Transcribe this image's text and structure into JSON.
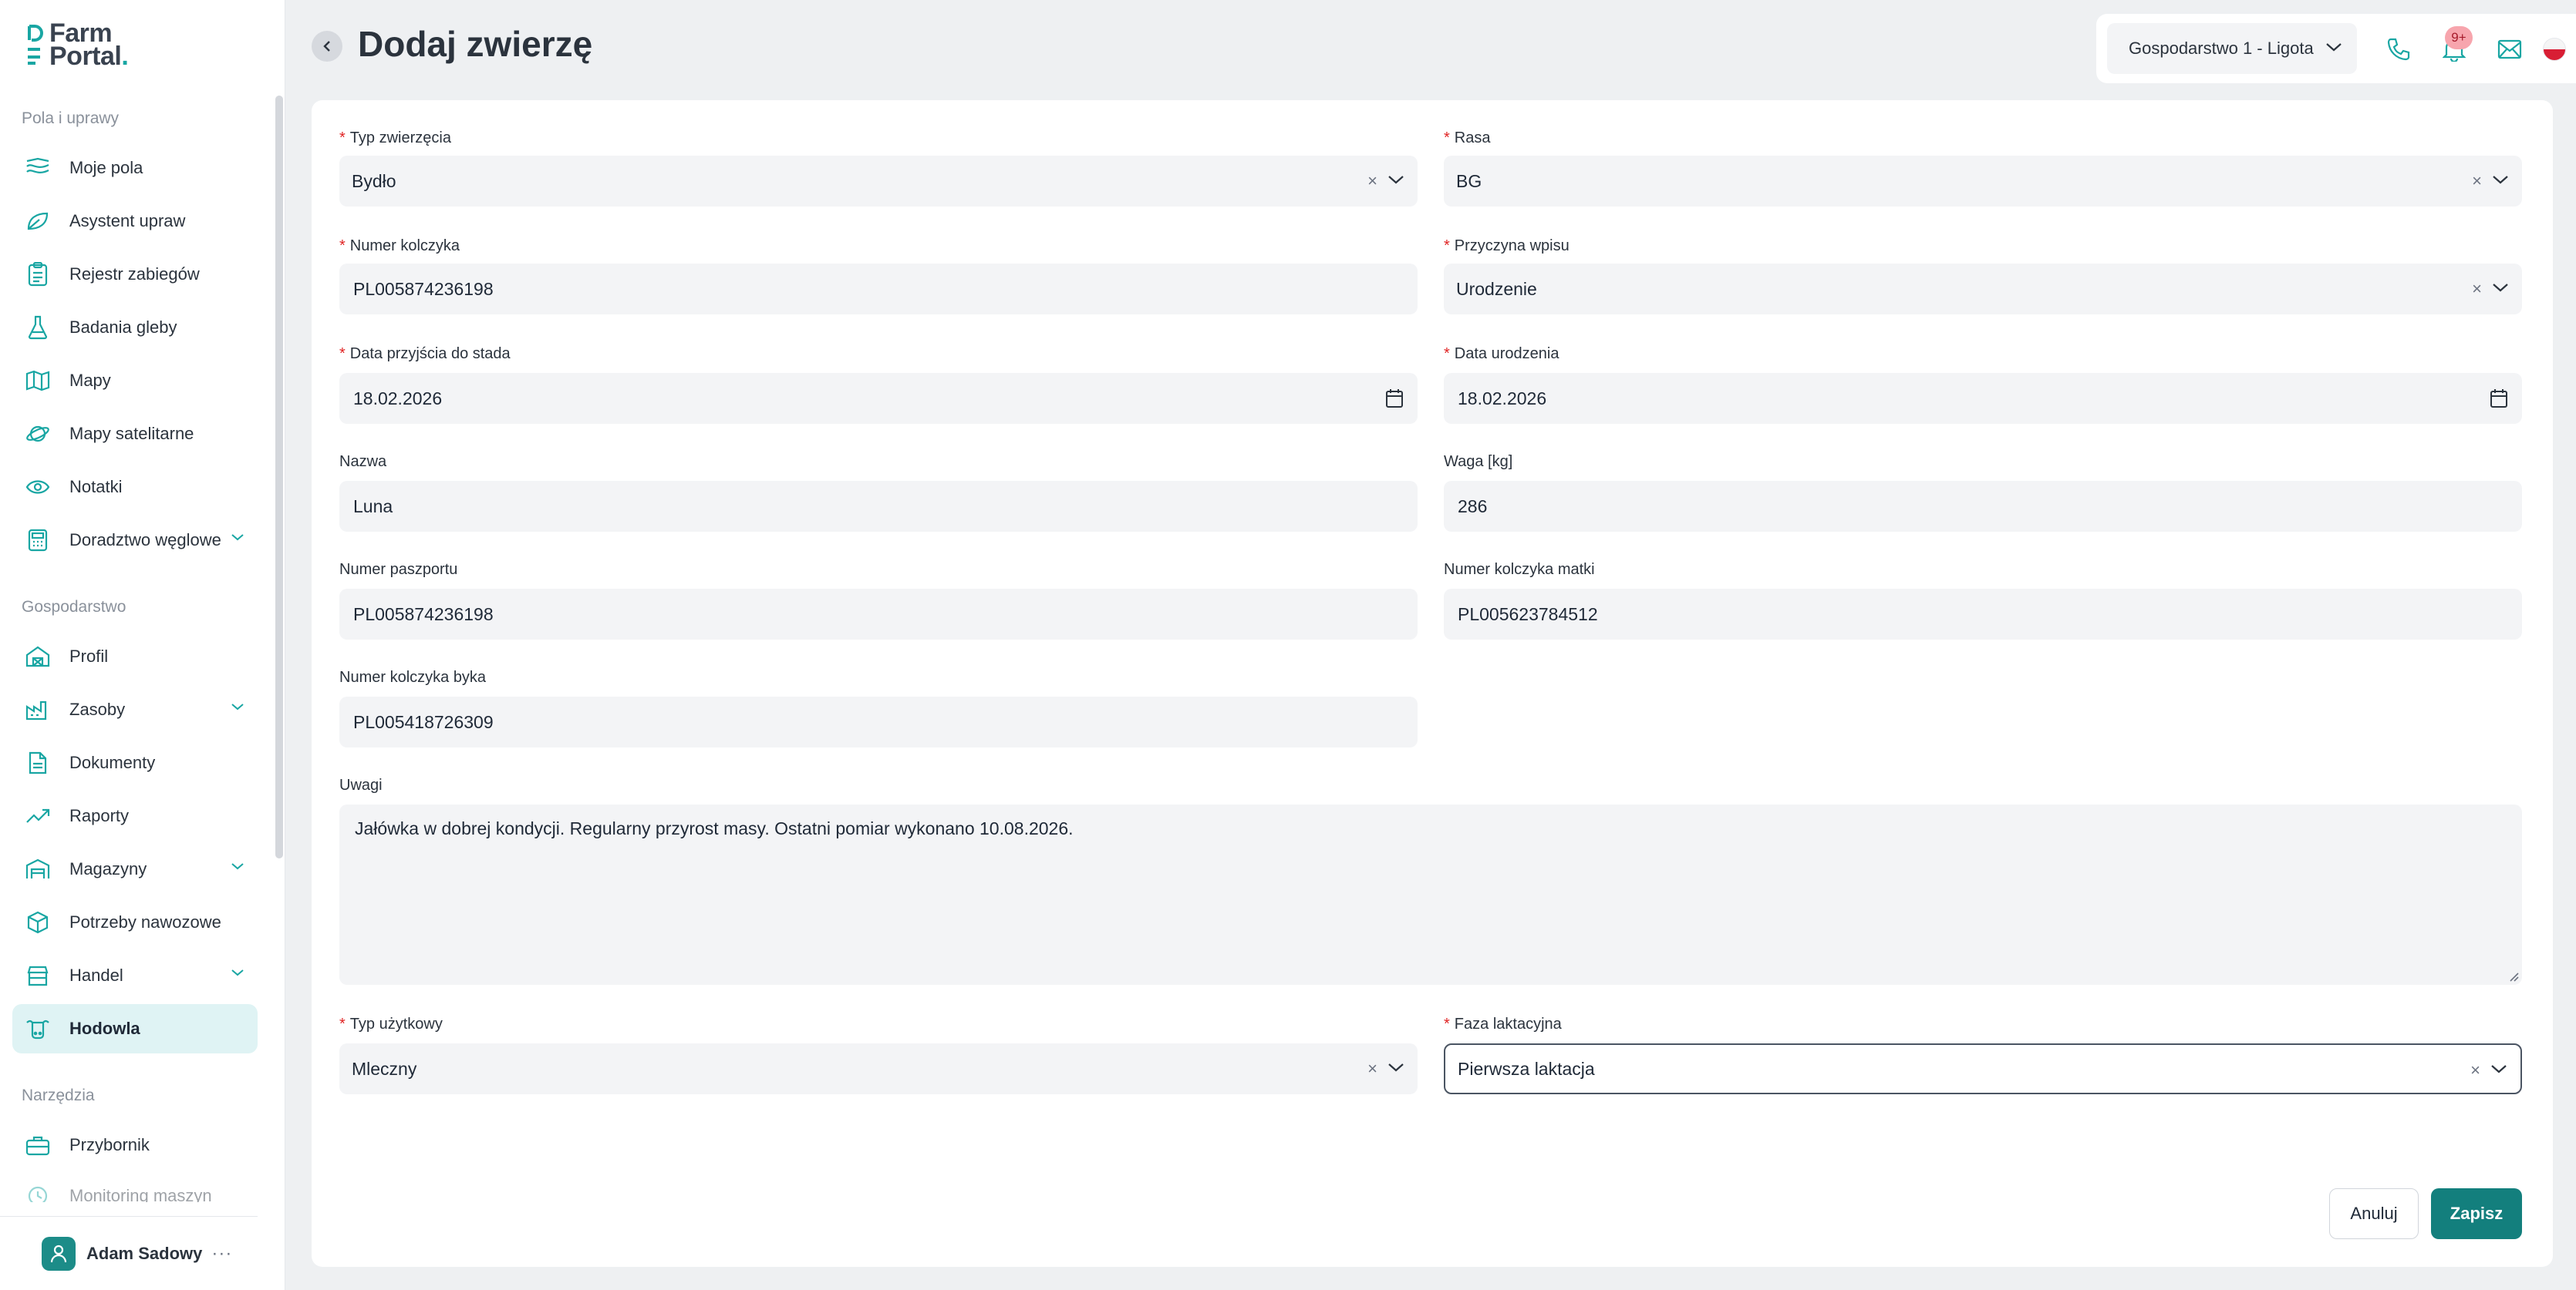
{
  "app": {
    "logo_line1": "Farm",
    "logo_line2": "Portal",
    "logo_dot": "."
  },
  "header": {
    "title": "Dodaj zwierzę",
    "farm": "Gospodarstwo 1 - Ligota",
    "notifications_badge": "9+"
  },
  "sidebar": {
    "sections": {
      "fields": "Pola i uprawy",
      "farm": "Gospodarstwo",
      "tools": "Narzędzia"
    },
    "items": [
      {
        "label": "Moje pola",
        "icon": "fields-icon"
      },
      {
        "label": "Asystent upraw",
        "icon": "leaf-icon"
      },
      {
        "label": "Rejestr zabiegów",
        "icon": "clipboard-icon"
      },
      {
        "label": "Badania gleby",
        "icon": "flask-icon"
      },
      {
        "label": "Mapy",
        "icon": "map-icon"
      },
      {
        "label": "Mapy satelitarne",
        "icon": "satellite-icon"
      },
      {
        "label": "Notatki",
        "icon": "eye-icon"
      },
      {
        "label": "Doradztwo węglowe",
        "icon": "calculator-icon"
      },
      {
        "label": "Profil",
        "icon": "barn-icon"
      },
      {
        "label": "Zasoby",
        "icon": "factory-icon"
      },
      {
        "label": "Dokumenty",
        "icon": "document-icon"
      },
      {
        "label": "Raporty",
        "icon": "trend-icon"
      },
      {
        "label": "Magazyny",
        "icon": "warehouse-icon"
      },
      {
        "label": "Potrzeby nawozowe",
        "icon": "cube-icon"
      },
      {
        "label": "Handel",
        "icon": "shop-icon"
      },
      {
        "label": "Hodowla",
        "icon": "cow-icon"
      },
      {
        "label": "Przybornik",
        "icon": "toolbox-icon"
      },
      {
        "label": "Monitoring maszyn",
        "icon": "monitor-icon"
      }
    ],
    "user": {
      "name": "Adam Sadowy",
      "more": "···"
    }
  },
  "form": {
    "animal_type": {
      "label": "Typ zwierzęcia",
      "value": "Bydło"
    },
    "breed": {
      "label": "Rasa",
      "value": "BG"
    },
    "tag_number": {
      "label": "Numer kolczyka",
      "value": "PL005874236198"
    },
    "entry_reason": {
      "label": "Przyczyna wpisu",
      "value": "Urodzenie"
    },
    "herd_date": {
      "label": "Data przyjścia do stada",
      "value": "18.02.2026"
    },
    "birth_date": {
      "label": "Data urodzenia",
      "value": "18.02.2026"
    },
    "name": {
      "label": "Nazwa",
      "value": "Luna"
    },
    "weight": {
      "label": "Waga [kg]",
      "value": "286"
    },
    "passport": {
      "label": "Numer paszportu",
      "value": "PL005874236198"
    },
    "mother_tag": {
      "label": "Numer kolczyka matki",
      "value": "PL005623784512"
    },
    "bull_tag": {
      "label": "Numer kolczyka byka",
      "value": "PL005418726309"
    },
    "notes": {
      "label": "Uwagi",
      "value": "Jałówka w dobrej kondycji. Regularny przyrost masy. Ostatni pomiar wykonano 10.08.2026."
    },
    "usage_type": {
      "label": "Typ użytkowy",
      "value": "Mleczny"
    },
    "lactation": {
      "label": "Faza laktacyjna",
      "value": "Pierwsza laktacja"
    },
    "required_mark": "*",
    "clear_glyph": "×",
    "cancel_label": "Anuluj",
    "save_label": "Zapisz"
  },
  "colors": {
    "accent": "#137f7d",
    "active_bg": "#dff3f4",
    "required": "#e02424"
  }
}
